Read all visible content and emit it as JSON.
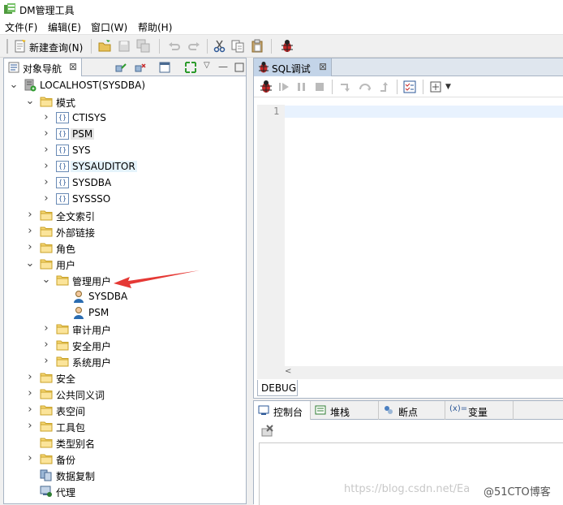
{
  "window": {
    "title": "DM管理工具"
  },
  "menu": {
    "file": "文件(F)",
    "edit": "编辑(E)",
    "window": "窗口(W)",
    "help": "帮助(H)"
  },
  "toolbar": {
    "new_query": "新建查询(N)"
  },
  "left_panel": {
    "tab_label": "对象导航",
    "tab_close": "⊠"
  },
  "tree": {
    "root": "LOCALHOST(SYSDBA)",
    "mode": "模式",
    "schemas": [
      "CTISYS",
      "PSM",
      "SYS",
      "SYSAUDITOR",
      "SYSDBA",
      "SYSSSO"
    ],
    "fulltext": "全文索引",
    "external_link": "外部链接",
    "role": "角色",
    "user": "用户",
    "admin_user": "管理用户",
    "admin_users": [
      "SYSDBA",
      "PSM"
    ],
    "audit_user": "审计用户",
    "security_user": "安全用户",
    "system_user": "系统用户",
    "security": "安全",
    "public_synonym": "公共同义词",
    "tablespace": "表空间",
    "package": "工具包",
    "type_alias": "类型别名",
    "backup": "备份",
    "data_replication": "数据复制",
    "agent": "代理"
  },
  "editor": {
    "tab_label": "SQL调试",
    "tab_close": "⊠",
    "line_number": "1",
    "debug_tab": "DEBUG"
  },
  "bottom": {
    "console": "控制台",
    "stack": "堆栈",
    "breakpoint": "断点",
    "variable": "变量"
  },
  "watermark": {
    "url": "https://blog.csdn.net/Ea",
    "brand": "@51CTO博客"
  }
}
